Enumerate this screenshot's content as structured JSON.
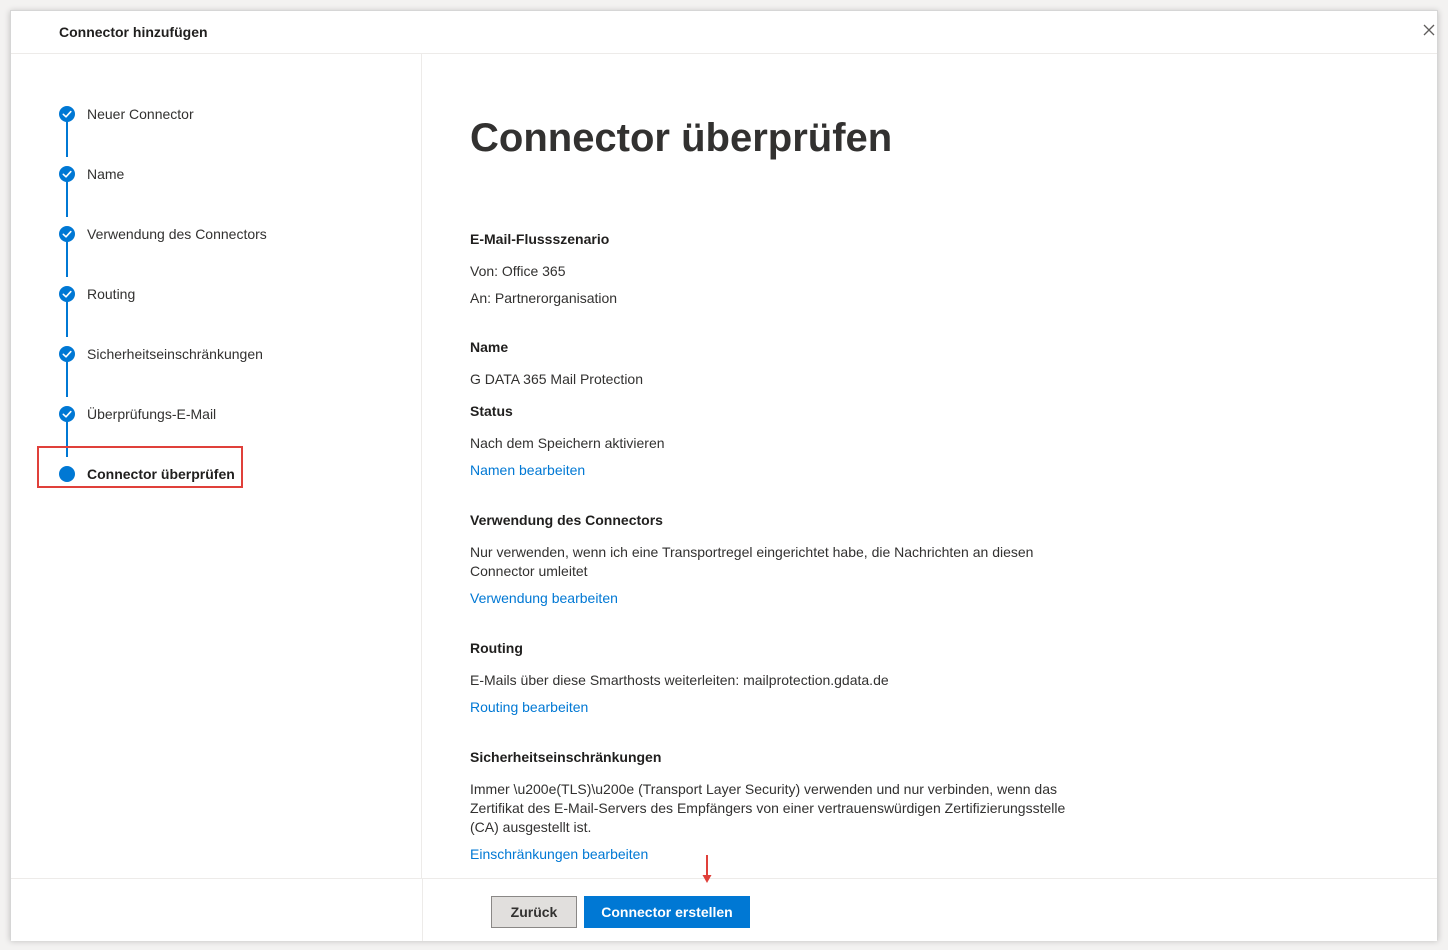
{
  "header": {
    "title": "Connector hinzufügen"
  },
  "steps": [
    {
      "label": "Neuer Connector",
      "state": "done"
    },
    {
      "label": "Name",
      "state": "done"
    },
    {
      "label": "Verwendung des Connectors",
      "state": "done"
    },
    {
      "label": "Routing",
      "state": "done"
    },
    {
      "label": "Sicherheitseinschränkungen",
      "state": "done"
    },
    {
      "label": "Überprüfungs-E-Mail",
      "state": "done"
    },
    {
      "label": "Connector überprüfen",
      "state": "current"
    }
  ],
  "main": {
    "title": "Connector überprüfen",
    "flow": {
      "title": "E-Mail-Flussszenario",
      "from": "Von: Office 365",
      "to": "An: Partnerorganisation"
    },
    "name": {
      "title": "Name",
      "value": "G DATA 365 Mail Protection"
    },
    "status": {
      "title": "Status",
      "value": "Nach dem Speichern aktivieren",
      "edit_link": "Namen bearbeiten"
    },
    "usage": {
      "title": "Verwendung des Connectors",
      "value": "Nur verwenden, wenn ich eine Transportregel eingerichtet habe, die Nachrichten an diesen Connector umleitet",
      "edit_link": "Verwendung bearbeiten"
    },
    "routing": {
      "title": "Routing",
      "value": "E-Mails über diese Smarthosts weiterleiten: mailprotection.gdata.de",
      "edit_link": "Routing bearbeiten"
    },
    "security": {
      "title": "Sicherheitseinschränkungen",
      "value": "Immer \\u200e(TLS)\\u200e (Transport Layer Security) verwenden und nur verbinden, wenn das Zertifikat des E-Mail-Servers des Empfängers von einer vertrauenswürdigen Zertifizierungsstelle (CA) ausgestellt ist.",
      "edit_link": "Einschränkungen bearbeiten"
    }
  },
  "footer": {
    "back_label": "Zurück",
    "create_label": "Connector erstellen"
  },
  "colors": {
    "accent": "#0078d4",
    "highlight": "#e0403a",
    "text": "#323130"
  },
  "icons": {
    "close": "close-icon",
    "step_done": "checkmark-circle-icon",
    "step_current": "dot-circle-icon",
    "annotation": "arrow-down-icon"
  }
}
